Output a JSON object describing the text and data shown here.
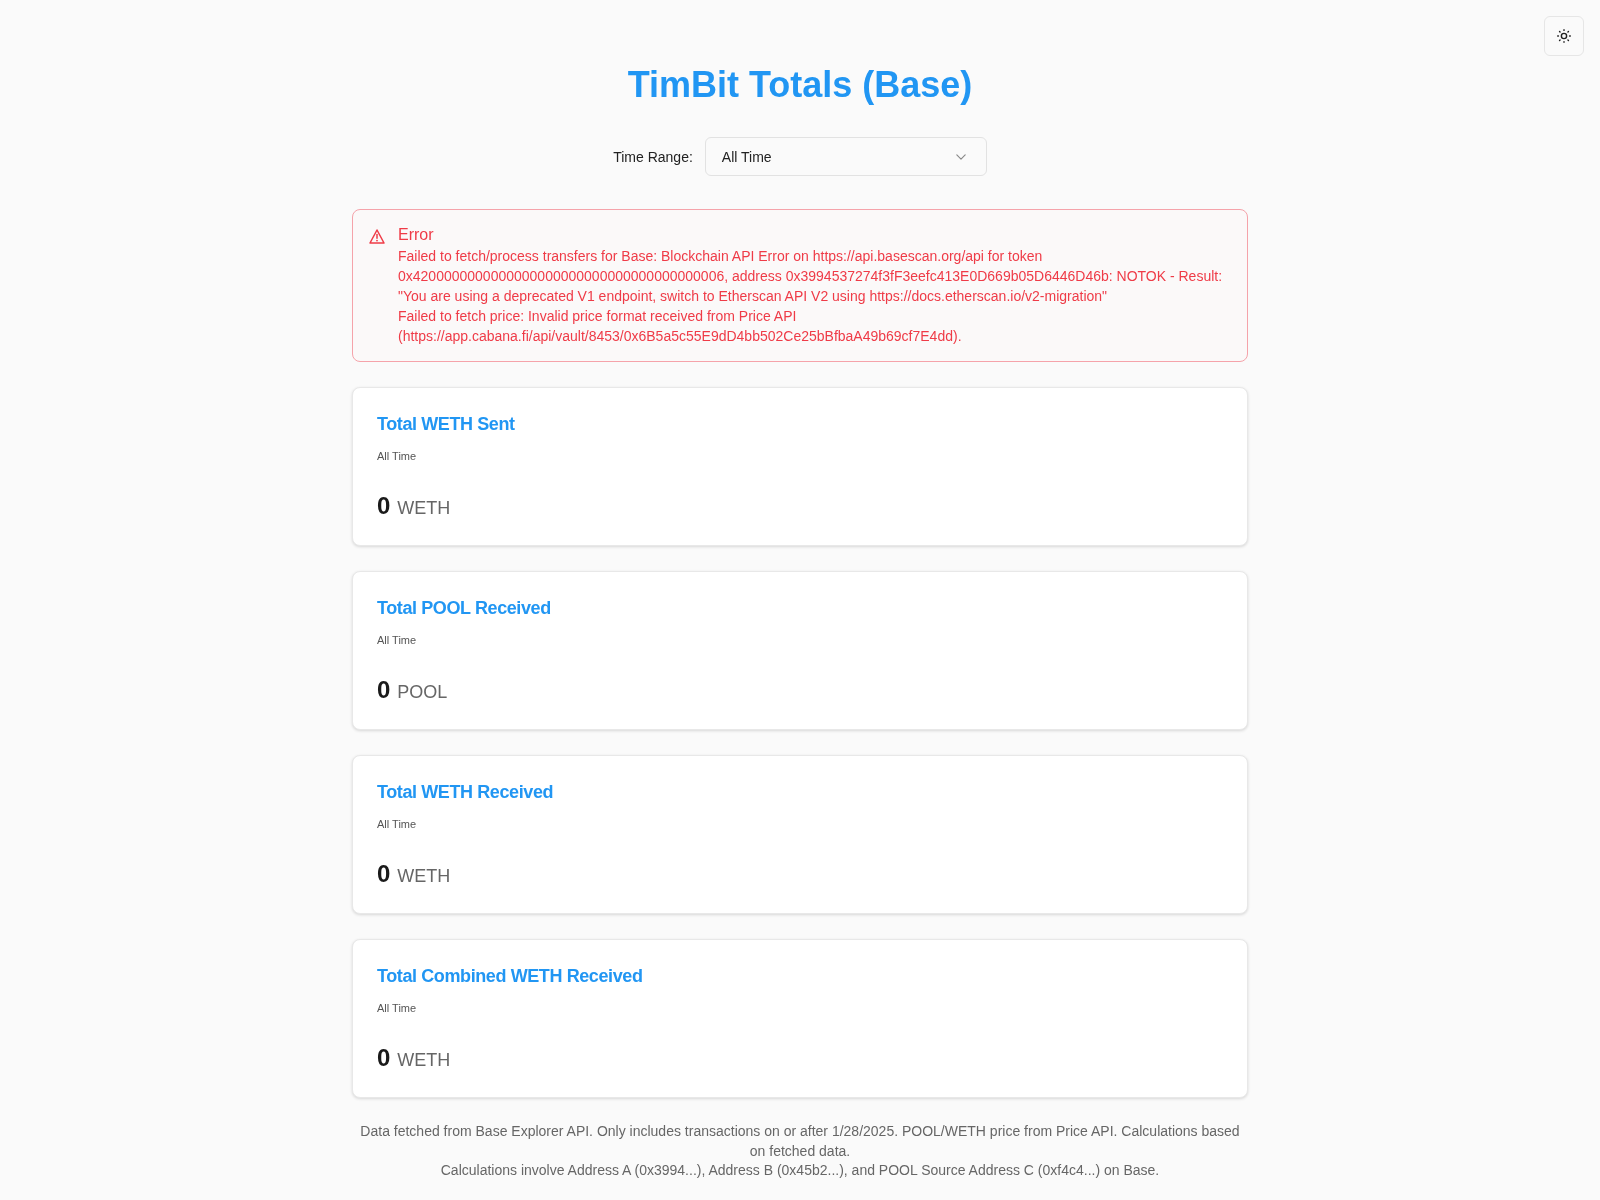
{
  "title": "TimBit Totals (Base)",
  "time_range": {
    "label": "Time Range:",
    "value": "All Time"
  },
  "error": {
    "title": "Error",
    "messages": [
      "Failed to fetch/process transfers for Base: Blockchain API Error on https://api.basescan.org/api for token 0x4200000000000000000000000000000000000006, address 0x3994537274f3fF3eefc413E0D669b05D6446D46b: NOTOK - Result: \"You are using a deprecated V1 endpoint, switch to Etherscan API V2 using https://docs.etherscan.io/v2-migration\"",
      "Failed to fetch price: Invalid price format received from Price API (https://app.cabana.fi/api/vault/8453/0x6B5a5c55E9dD4bb502Ce25bBfbaA49b69cf7E4dd)."
    ]
  },
  "cards": [
    {
      "title": "Total WETH Sent",
      "period": "All Time",
      "value": "0",
      "unit": "WETH"
    },
    {
      "title": "Total POOL Received",
      "period": "All Time",
      "value": "0",
      "unit": "POOL"
    },
    {
      "title": "Total WETH Received",
      "period": "All Time",
      "value": "0",
      "unit": "WETH"
    },
    {
      "title": "Total Combined WETH Received",
      "period": "All Time",
      "value": "0",
      "unit": "WETH"
    }
  ],
  "footer": [
    "Data fetched from Base Explorer API. Only includes transactions on or after 1/28/2025. POOL/WETH price from Price API. Calculations based on fetched data.",
    "Calculations involve Address A (0x3994...), Address B (0x45b2...), and POOL Source Address C (0xf4c4...) on Base."
  ]
}
